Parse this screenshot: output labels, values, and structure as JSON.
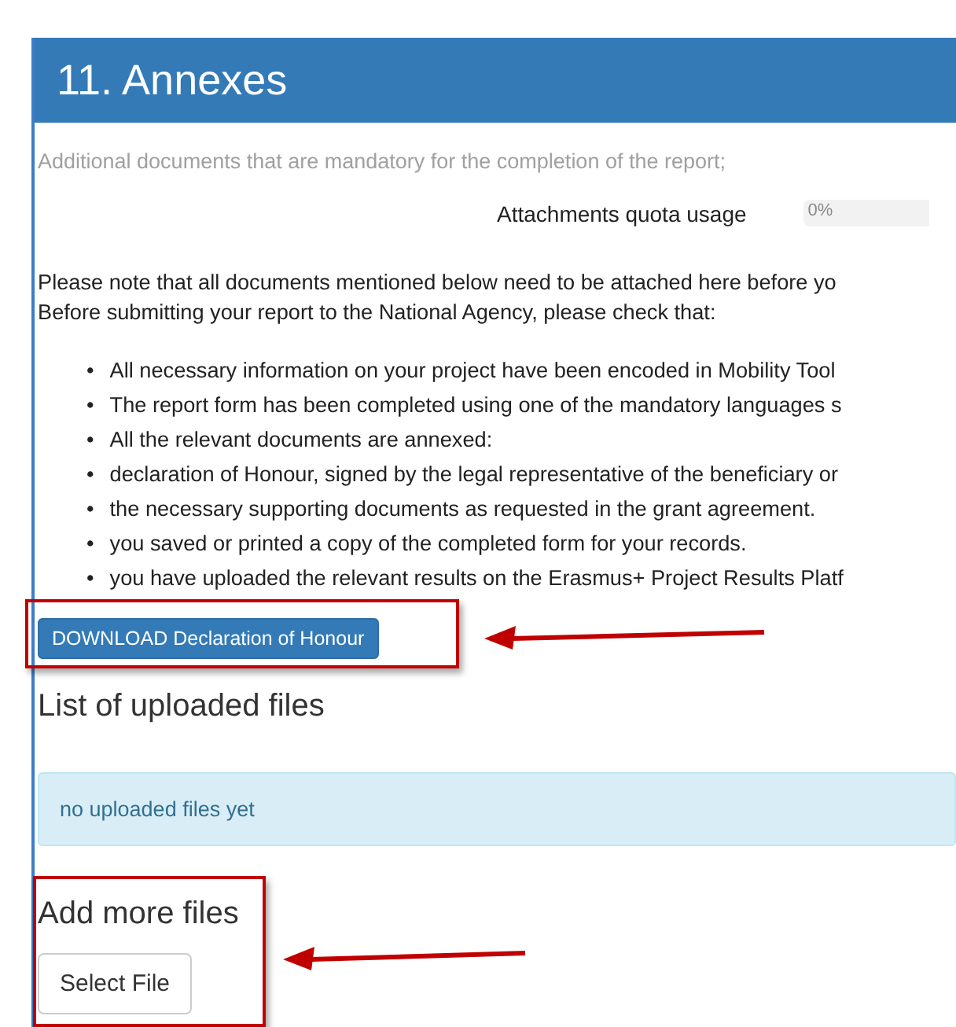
{
  "header": {
    "title": "11. Annexes"
  },
  "subtitle": "Additional documents that are mandatory for the completion of the report;",
  "quota": {
    "label": "Attachments quota usage",
    "level": 0,
    "reading": "0%"
  },
  "intro": [
    "Please note that all documents mentioned below need to be attached here before yo",
    "Before submitting your report to the National Agency, please check that:"
  ],
  "bullet": "•",
  "checklist": [
    "All necessary information on your project have been encoded in Mobility Tool",
    "The report form has been completed using one of the mandatory languages s",
    "All the relevant documents are annexed:",
    "declaration of Honour, signed by the legal representative of the beneficiary or",
    "the necessary supporting documents as requested in the grant agreement.",
    "you saved or printed a copy of the completed form for your records.",
    "you have uploaded the relevant results on the Erasmus+ Project Results Platf"
  ],
  "download_button": "DOWNLOAD Declaration of Honour",
  "uploaded": {
    "heading": "List of uploaded files",
    "empty_message": "no uploaded files yet"
  },
  "add_files": {
    "heading": "Add more files",
    "button": "Select File"
  }
}
